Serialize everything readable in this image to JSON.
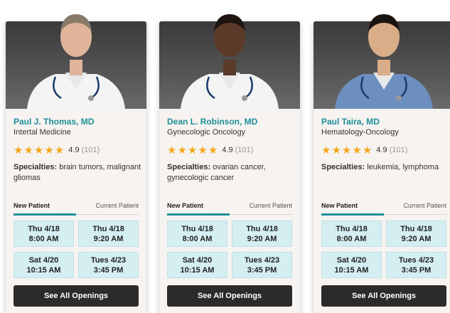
{
  "doctors": [
    {
      "name": "Paul J. Thomas, MD",
      "specialty": "Intertal Medicine",
      "rating": "4.9",
      "review_count": "(101)",
      "specialties_label": "Specialties:",
      "specialties_text": " brain tumors, malignant gliomas",
      "tabs": {
        "active": "New Patient",
        "other": "Current Patient"
      },
      "slots": [
        {
          "day": "Thu 4/18",
          "time": "8:00 AM"
        },
        {
          "day": "Thu 4/18",
          "time": "9:20 AM"
        },
        {
          "day": "Sat 4/20",
          "time": "10:15 AM"
        },
        {
          "day": "Tues 4/23",
          "time": "3:45 PM"
        }
      ],
      "cta": "See All Openings",
      "scrub_color": "#f4f4f4",
      "skin_color": "#e0b49a",
      "hair_color": "#8a7a6a"
    },
    {
      "name": "Dean L. Robinson, MD",
      "specialty": "Gynecologic Oncology",
      "rating": "4.9",
      "review_count": "(101)",
      "specialties_label": "Specialties:",
      "specialties_text": " ovarian cancer, gynecologic cancer",
      "tabs": {
        "active": "New Patient",
        "other": "Current Patient"
      },
      "slots": [
        {
          "day": "Thu 4/18",
          "time": "8:00 AM"
        },
        {
          "day": "Thu 4/18",
          "time": "9:20 AM"
        },
        {
          "day": "Sat 4/20",
          "time": "10:15 AM"
        },
        {
          "day": "Tues 4/23",
          "time": "3:45 PM"
        }
      ],
      "cta": "See All Openings",
      "scrub_color": "#f4f4f4",
      "skin_color": "#5a3a28",
      "hair_color": "#1e1410"
    },
    {
      "name": "Paul Taira, MD",
      "specialty": "Hematology-Oncology",
      "rating": "4.9",
      "review_count": "(101)",
      "specialties_label": "Specialties:",
      "specialties_text": " leukemia, lymphoma",
      "tabs": {
        "active": "New Patient",
        "other": "Current Patient"
      },
      "slots": [
        {
          "day": "Thu 4/18",
          "time": "8:00 AM"
        },
        {
          "day": "Thu 4/18",
          "time": "9:20 AM"
        },
        {
          "day": "Sat 4/20",
          "time": "10:15 AM"
        },
        {
          "day": "Tues 4/23",
          "time": "3:45 PM"
        }
      ],
      "cta": "See All Openings",
      "scrub_color": "#6c8fbf",
      "skin_color": "#d8ad88",
      "hair_color": "#1a1410"
    }
  ],
  "colors": {
    "accent": "#1e8f9b",
    "star": "#f3a71b",
    "slot_bg": "#d4eef1",
    "cta_bg": "#2b2b2b"
  }
}
